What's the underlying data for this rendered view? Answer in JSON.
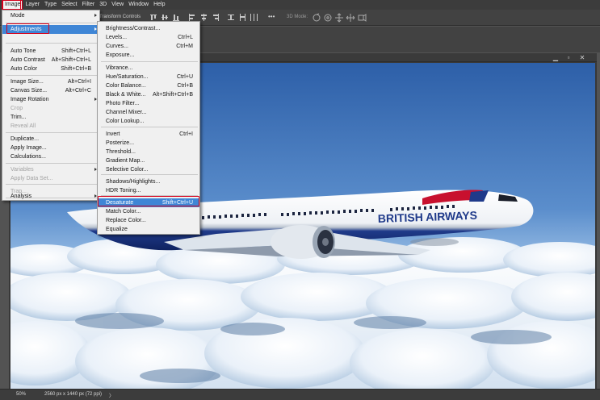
{
  "menubar": {
    "items": [
      "Image",
      "Layer",
      "Type",
      "Select",
      "Filter",
      "3D",
      "View",
      "Window",
      "Help"
    ]
  },
  "optionsbar": {
    "transform_controls_label": "Transform Controls",
    "mode_3d_label": "3D Mode:",
    "more_label": "•••"
  },
  "image_menu": {
    "items": [
      {
        "label": "Mode",
        "shortcut": "",
        "submenu": true,
        "disabled": false
      },
      {
        "label": "Adjustments",
        "shortcut": "",
        "submenu": true,
        "disabled": false,
        "highlighted": true
      },
      {
        "label": "Auto Tone",
        "shortcut": "Shift+Ctrl+L",
        "disabled": false
      },
      {
        "label": "Auto Contrast",
        "shortcut": "Alt+Shift+Ctrl+L",
        "disabled": false
      },
      {
        "label": "Auto Color",
        "shortcut": "Shift+Ctrl+B",
        "disabled": false
      },
      {
        "label": "Image Size...",
        "shortcut": "Alt+Ctrl+I",
        "disabled": false
      },
      {
        "label": "Canvas Size...",
        "shortcut": "Alt+Ctrl+C",
        "disabled": false
      },
      {
        "label": "Image Rotation",
        "shortcut": "",
        "submenu": true,
        "disabled": false
      },
      {
        "label": "Crop",
        "shortcut": "",
        "disabled": true
      },
      {
        "label": "Trim...",
        "shortcut": "",
        "disabled": false
      },
      {
        "label": "Reveal All",
        "shortcut": "",
        "disabled": true
      },
      {
        "label": "Duplicate...",
        "shortcut": "",
        "disabled": false
      },
      {
        "label": "Apply Image...",
        "shortcut": "",
        "disabled": false
      },
      {
        "label": "Calculations...",
        "shortcut": "",
        "disabled": false
      },
      {
        "label": "Variables",
        "shortcut": "",
        "submenu": true,
        "disabled": true
      },
      {
        "label": "Apply Data Set...",
        "shortcut": "",
        "disabled": true
      },
      {
        "label": "Trap...",
        "shortcut": "",
        "disabled": true
      },
      {
        "label": "Analysis",
        "shortcut": "",
        "submenu": true,
        "disabled": false
      }
    ]
  },
  "adjustments_menu": {
    "items": [
      {
        "label": "Brightness/Contrast...",
        "shortcut": ""
      },
      {
        "label": "Levels...",
        "shortcut": "Ctrl+L"
      },
      {
        "label": "Curves...",
        "shortcut": "Ctrl+M"
      },
      {
        "label": "Exposure...",
        "shortcut": ""
      },
      {
        "label": "Vibrance...",
        "shortcut": ""
      },
      {
        "label": "Hue/Saturation...",
        "shortcut": "Ctrl+U"
      },
      {
        "label": "Color Balance...",
        "shortcut": "Ctrl+B"
      },
      {
        "label": "Black & White...",
        "shortcut": "Alt+Shift+Ctrl+B"
      },
      {
        "label": "Photo Filter...",
        "shortcut": ""
      },
      {
        "label": "Channel Mixer...",
        "shortcut": ""
      },
      {
        "label": "Color Lookup...",
        "shortcut": ""
      },
      {
        "label": "Invert",
        "shortcut": "Ctrl+I"
      },
      {
        "label": "Posterize...",
        "shortcut": ""
      },
      {
        "label": "Threshold...",
        "shortcut": ""
      },
      {
        "label": "Gradient Map...",
        "shortcut": ""
      },
      {
        "label": "Selective Color...",
        "shortcut": ""
      },
      {
        "label": "Shadows/Highlights...",
        "shortcut": ""
      },
      {
        "label": "HDR Toning...",
        "shortcut": ""
      },
      {
        "label": "Desaturate",
        "shortcut": "Shift+Ctrl+U",
        "highlighted": true
      },
      {
        "label": "Match Color...",
        "shortcut": ""
      },
      {
        "label": "Replace Color...",
        "shortcut": ""
      },
      {
        "label": "Equalize",
        "shortcut": ""
      }
    ]
  },
  "document": {
    "airline_livery_text": "BRITISH AIRWAYS"
  },
  "statusbar": {
    "zoom": "50%",
    "doc_info": "2560 px x 1440 px (72 ppi)",
    "arrow": "〉"
  },
  "colors": {
    "highlight": "#3f86d6",
    "annotation_red": "#d6001c",
    "sky_top": "#2d5fa8",
    "ba_blue": "#1f3a8a",
    "ba_red": "#c8102e"
  }
}
